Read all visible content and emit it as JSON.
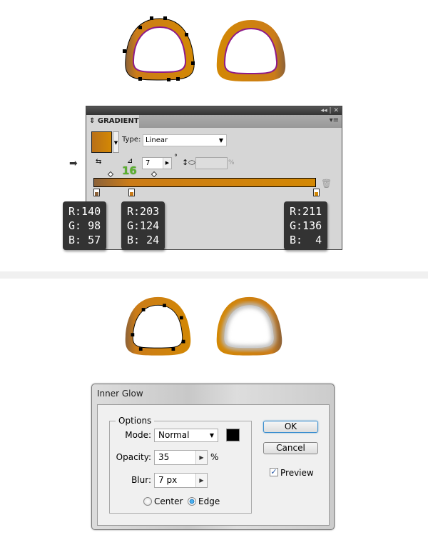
{
  "colors": {
    "stroke_orange": "#d38804",
    "stroke_brown": "#8c6239",
    "inner_stroke": "#8e1a8a"
  },
  "gradient_panel": {
    "title": "GRADIENT",
    "collapse_icon": "double-chevron-left-icon",
    "close_icon": "close-icon",
    "menu_icon": "panel-menu-icon",
    "type_label": "Type:",
    "type_value": "Linear",
    "angle_value": "7",
    "degree_symbol": "°",
    "aspect_value": "",
    "percent": "%",
    "annotation_number": "16",
    "stops": [
      {
        "location": 0,
        "color": "#8c6239",
        "rgb": "R:140\nG: 98\nB: 57"
      },
      {
        "location": 16,
        "color": "#cb7c18",
        "rgb": "R:203\nG:124\nB: 24"
      },
      {
        "location": 100,
        "color": "#d38804",
        "rgb": "R:211\nG:136\nB:  4"
      }
    ]
  },
  "inner_glow": {
    "title": "Inner Glow",
    "options_label": "Options",
    "mode_label": "Mode:",
    "mode_value": "Normal",
    "glow_color": "#000000",
    "opacity_label": "Opacity:",
    "opacity_value": "35",
    "percent": "%",
    "blur_label": "Blur:",
    "blur_value": "7 px",
    "center_label": "Center",
    "edge_label": "Edge",
    "selected_source": "Edge",
    "ok_label": "OK",
    "cancel_label": "Cancel",
    "preview_label": "Preview",
    "preview_checked": true
  }
}
